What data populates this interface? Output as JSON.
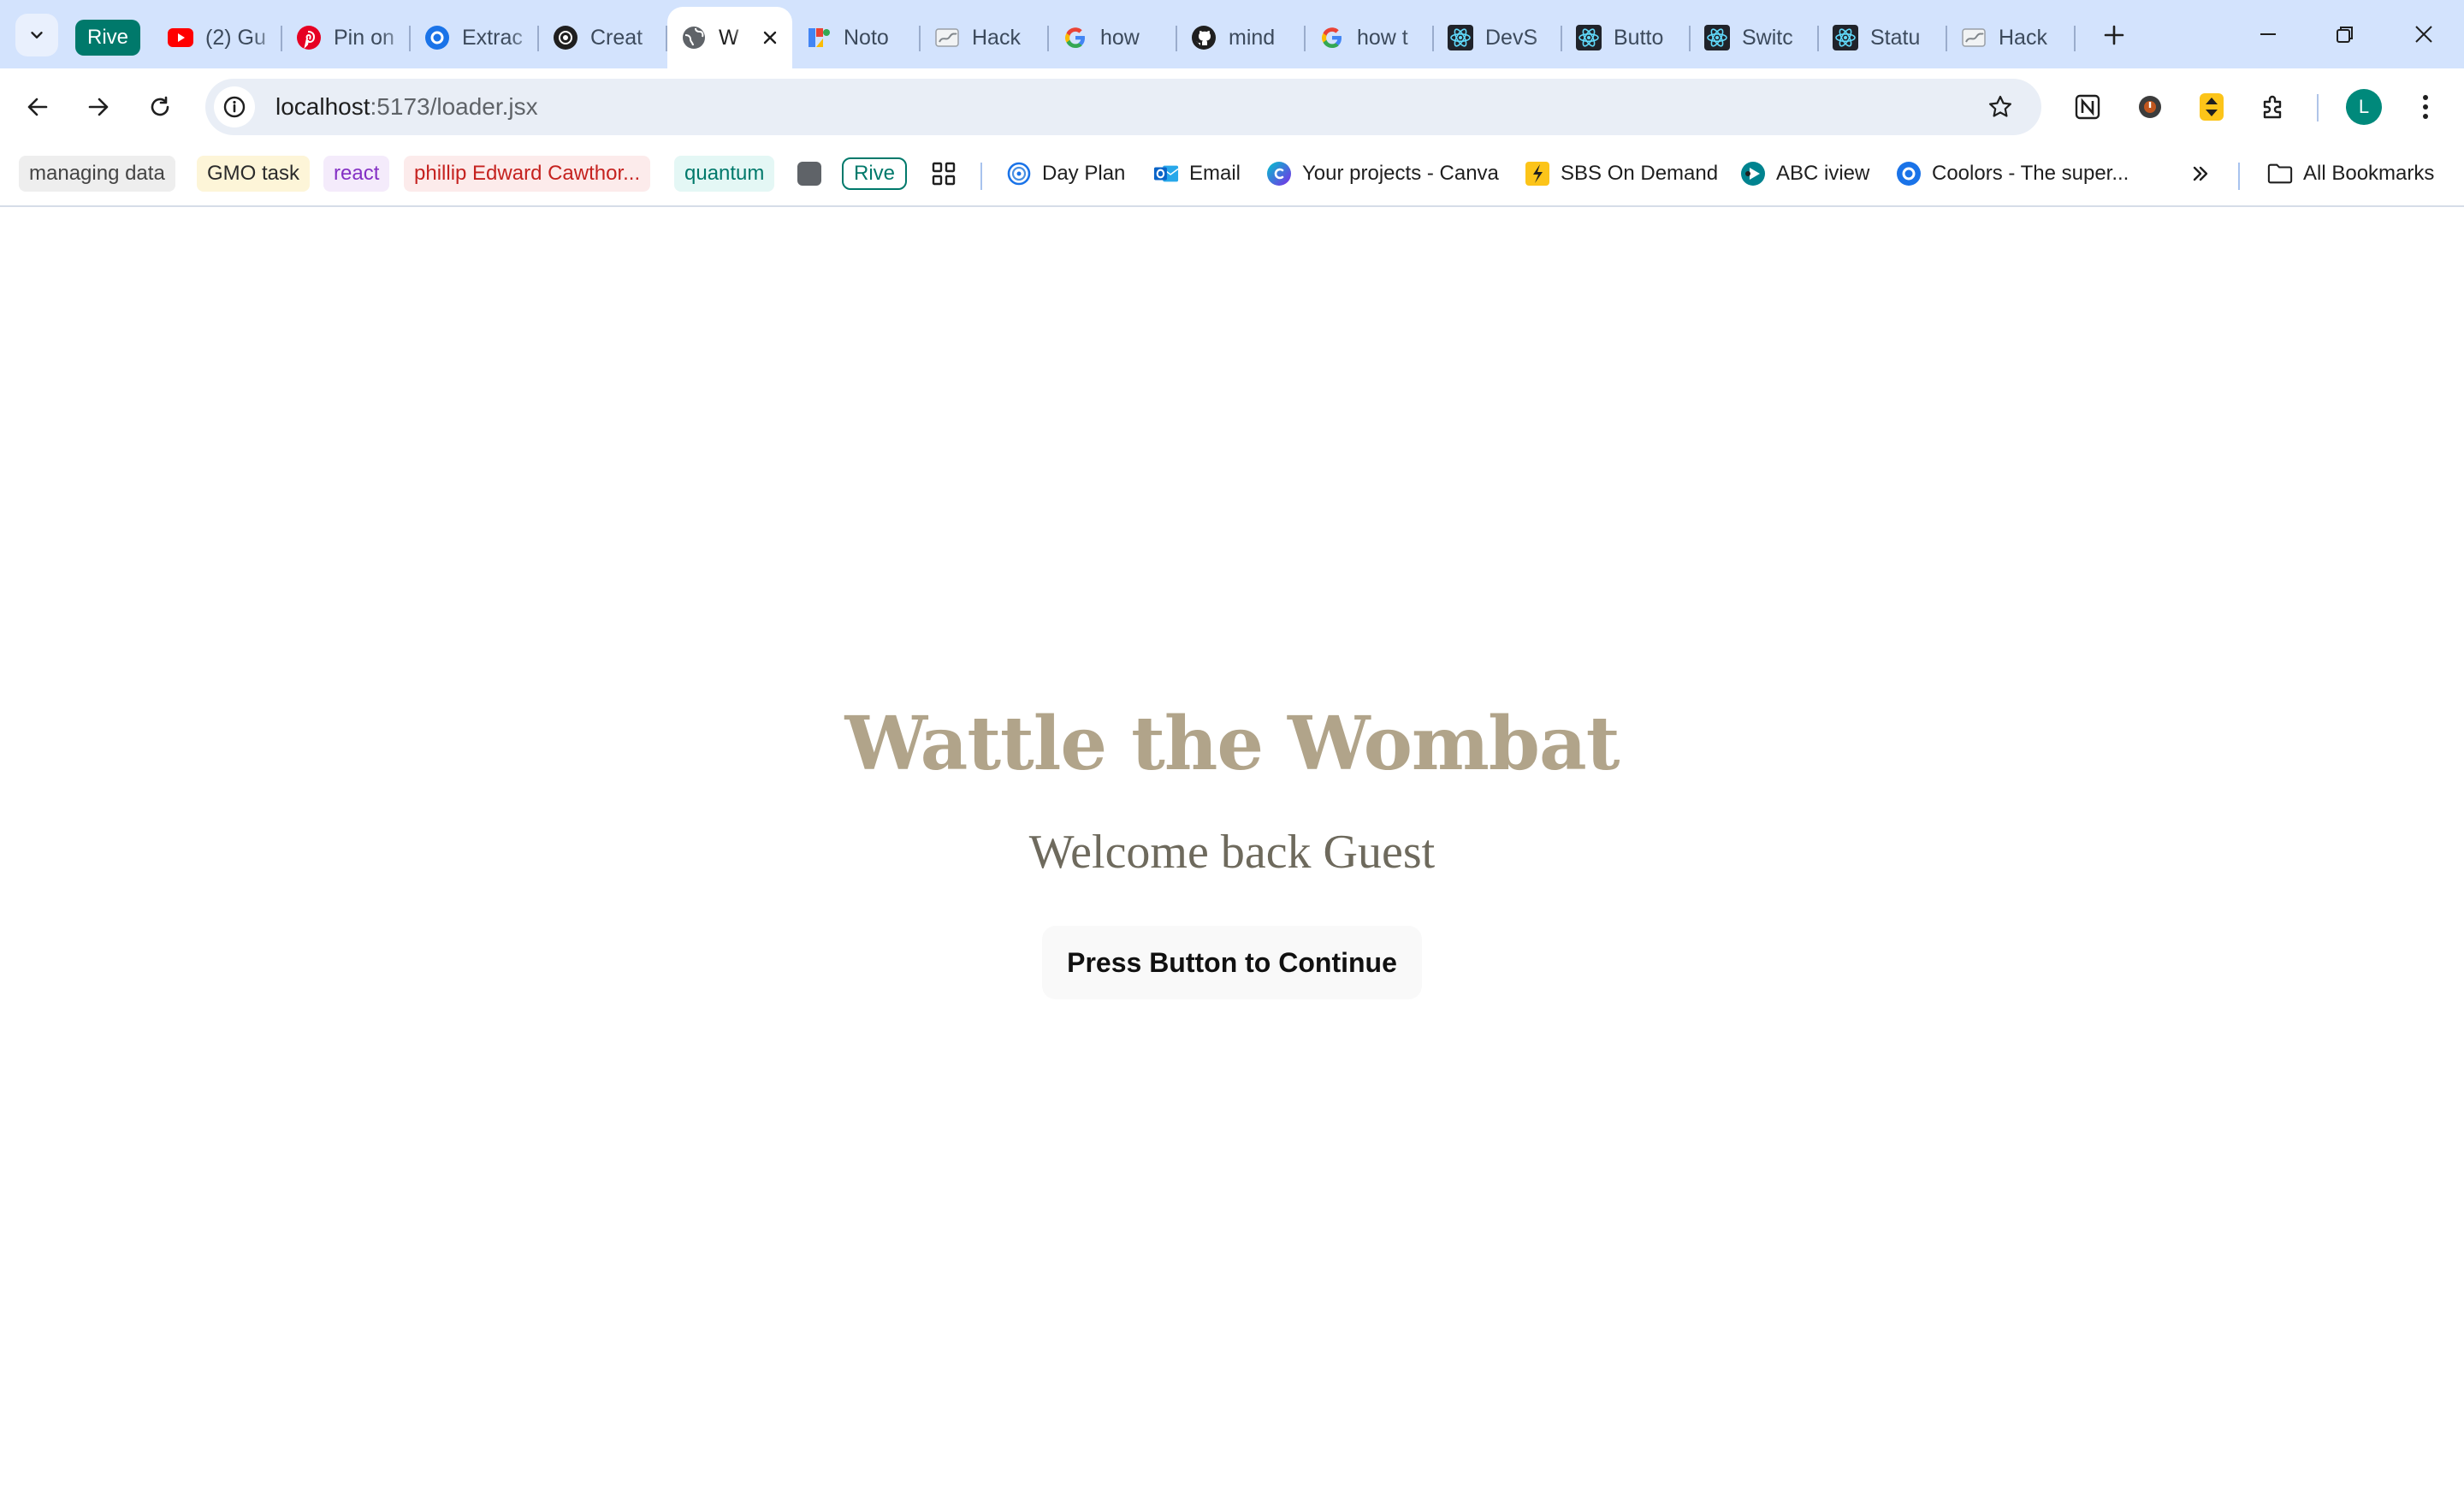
{
  "browser": {
    "tab_group_label": "Rive",
    "tabs": [
      {
        "title": "(2) Gu",
        "icon": "youtube-icon"
      },
      {
        "title": "Pin on",
        "icon": "pinterest-icon"
      },
      {
        "title": "Extrac",
        "icon": "canva-icon"
      },
      {
        "title": "Creat",
        "icon": "openai-icon"
      },
      {
        "title": "W",
        "icon": "globe-icon",
        "active": true
      },
      {
        "title": "Noto",
        "icon": "google-fonts-icon"
      },
      {
        "title": "Hack",
        "icon": "hackathon-icon"
      },
      {
        "title": "how",
        "icon": "google-icon"
      },
      {
        "title": "mind",
        "icon": "github-icon"
      },
      {
        "title": "how t",
        "icon": "google-icon"
      },
      {
        "title": "DevS",
        "icon": "react-icon"
      },
      {
        "title": "Butto",
        "icon": "react-icon"
      },
      {
        "title": "Switc",
        "icon": "react-icon"
      },
      {
        "title": "Statu",
        "icon": "react-icon"
      },
      {
        "title": "Hack",
        "icon": "hackathon-icon"
      }
    ],
    "url_host": "localhost",
    "url_rest": ":5173/loader.jsx",
    "avatar_letter": "L",
    "bookmarks": {
      "chips": [
        {
          "label": "managing data",
          "bg": "#eeeeee",
          "fg": "#444444"
        },
        {
          "label": "GMO task",
          "bg": "#fdf5d8",
          "fg": "#2b2b2b"
        },
        {
          "label": "react",
          "bg": "#f4ebfb",
          "fg": "#8430c4"
        },
        {
          "label": "phillip Edward Cawthor...",
          "bg": "#fcebeb",
          "fg": "#c5221f"
        },
        {
          "label": "quantum",
          "bg": "#e4f7f5",
          "fg": "#00796b"
        }
      ],
      "rive_label": "Rive",
      "links": [
        {
          "label": "Day Plan",
          "icon": "dayplan-icon"
        },
        {
          "label": "Email",
          "icon": "outlook-icon"
        },
        {
          "label": "Your projects - Canva",
          "icon": "canva-icon"
        },
        {
          "label": "SBS On Demand",
          "icon": "sbs-icon"
        },
        {
          "label": "ABC iview",
          "icon": "abc-iview-icon"
        },
        {
          "label": "Coolors - The super...",
          "icon": "coolors-icon"
        }
      ],
      "all_bookmarks_label": "All Bookmarks"
    }
  },
  "page": {
    "title": "Wattle the Wombat",
    "subtitle": "Welcome back Guest",
    "button_label": "Press Button to Continue"
  },
  "colors": {
    "title": "#b1a48a",
    "subtitle": "#6e6a5d",
    "tabstrip": "#d3e3fd",
    "tab_group": "#00796b"
  }
}
